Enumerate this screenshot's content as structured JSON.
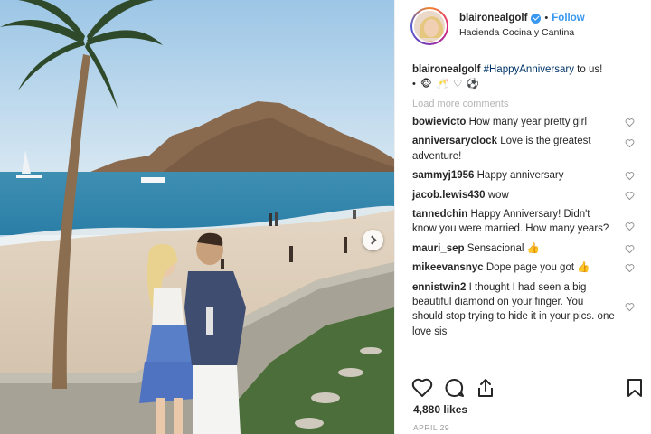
{
  "post": {
    "username": "blaironealgolf",
    "verified": true,
    "follow_label": "Follow",
    "separator": "•",
    "location": "Hacienda Cocina y Cantina",
    "caption": {
      "username": "blaironealgolf",
      "hashtag": "#HappyAnniversary",
      "text": " to us!",
      "emoji_line": "• 🐵 🥂 ♡ ⚽"
    },
    "load_more_label": "Load more comments",
    "comments": [
      {
        "username": "bowievicto",
        "text": "How many year pretty girl"
      },
      {
        "username": "anniversaryclock",
        "text": "Love is the greatest adventure!"
      },
      {
        "username": "sammyj1956",
        "text": "Happy anniversary"
      },
      {
        "username": "jacob.lewis430",
        "text": "wow"
      },
      {
        "username": "tannedchin",
        "text": "Happy Anniversary! Didn't know you were married. How many years?"
      },
      {
        "username": "mauri_sep",
        "text": "Sensacional 👍"
      },
      {
        "username": "mikeevansnyc",
        "text": "Dope page you got 👍"
      },
      {
        "username": "ennistwin2",
        "text": "I thought I had seen a big beautiful diamond on your finger. You should stop trying to hide it in your pics. one love sis"
      }
    ],
    "likes": "4,880 likes",
    "date": "APRIL 29"
  },
  "colors": {
    "link_blue": "#3897f0",
    "hashtag_blue": "#003569",
    "muted_gray": "#b5b5b5"
  },
  "icons": [
    "verified-badge-icon",
    "heart-icon",
    "comment-icon",
    "share-icon",
    "bookmark-icon",
    "chevron-right-icon"
  ]
}
